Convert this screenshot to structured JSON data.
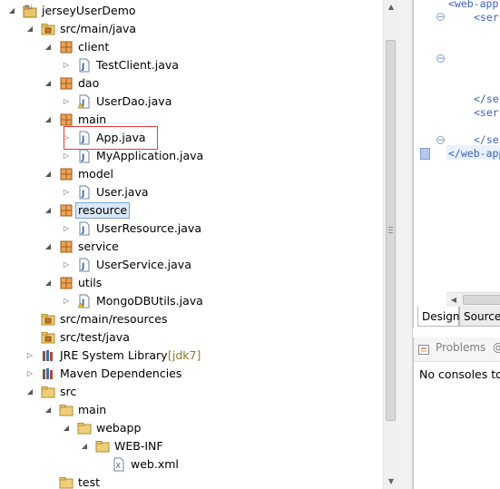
{
  "explorer": {
    "rows": [
      {
        "label": "jerseyUserDemo",
        "depth": 0,
        "twisty": "open",
        "icon": "project-icon"
      },
      {
        "label": "src/main/java",
        "depth": 1,
        "twisty": "open",
        "icon": "source-folder-icon"
      },
      {
        "label": "client",
        "depth": 2,
        "twisty": "open",
        "icon": "package-icon"
      },
      {
        "label": "TestClient.java",
        "depth": 3,
        "twisty": "closed",
        "icon": "java-file-icon"
      },
      {
        "label": "dao",
        "depth": 2,
        "twisty": "open",
        "icon": "package-icon"
      },
      {
        "label": "UserDao.java",
        "depth": 3,
        "twisty": "closed",
        "icon": "java-file-warn-icon"
      },
      {
        "label": "main",
        "depth": 2,
        "twisty": "open",
        "icon": "package-icon"
      },
      {
        "label": "App.java",
        "depth": 3,
        "twisty": "closed",
        "icon": "java-file-icon"
      },
      {
        "label": "MyApplication.java",
        "depth": 3,
        "twisty": "closed",
        "icon": "java-file-icon"
      },
      {
        "label": "model",
        "depth": 2,
        "twisty": "open",
        "icon": "package-icon"
      },
      {
        "label": "User.java",
        "depth": 3,
        "twisty": "closed",
        "icon": "java-file-icon"
      },
      {
        "label": "resource",
        "depth": 2,
        "twisty": "open",
        "icon": "package-icon",
        "selected": true
      },
      {
        "label": "UserResource.java",
        "depth": 3,
        "twisty": "closed",
        "icon": "java-file-icon"
      },
      {
        "label": "service",
        "depth": 2,
        "twisty": "open",
        "icon": "package-icon"
      },
      {
        "label": "UserService.java",
        "depth": 3,
        "twisty": "closed",
        "icon": "java-file-icon"
      },
      {
        "label": "utils",
        "depth": 2,
        "twisty": "open",
        "icon": "package-icon"
      },
      {
        "label": "MongoDBUtils.java",
        "depth": 3,
        "twisty": "closed",
        "icon": "java-file-warn-icon"
      },
      {
        "label": "src/main/resources",
        "depth": 1,
        "twisty": "none",
        "icon": "source-folder-icon"
      },
      {
        "label": "src/test/java",
        "depth": 1,
        "twisty": "none",
        "icon": "source-folder-icon"
      },
      {
        "label": "JRE System Library",
        "decoration": " [jdk7]",
        "depth": 1,
        "twisty": "closed",
        "icon": "library-icon"
      },
      {
        "label": "Maven Dependencies",
        "depth": 1,
        "twisty": "closed",
        "icon": "library-icon"
      },
      {
        "label": "src",
        "depth": 1,
        "twisty": "open",
        "icon": "folder-icon"
      },
      {
        "label": "main",
        "depth": 2,
        "twisty": "open",
        "icon": "folder-icon"
      },
      {
        "label": "webapp",
        "depth": 3,
        "twisty": "open",
        "icon": "folder-icon"
      },
      {
        "label": "WEB-INF",
        "depth": 4,
        "twisty": "open",
        "icon": "folder-icon"
      },
      {
        "label": "web.xml",
        "depth": 5,
        "twisty": "none",
        "icon": "xml-file-icon"
      },
      {
        "label": "test",
        "depth": 2,
        "twisty": "none",
        "icon": "folder-icon"
      }
    ]
  },
  "editor": {
    "lines": [
      {
        "text": "<web-app",
        "indent": 0,
        "row": 0
      },
      {
        "text": "<ser",
        "indent": 1,
        "row": 1
      },
      {
        "text": "</se",
        "indent": 1,
        "row": 7
      },
      {
        "text": "<ser",
        "indent": 1,
        "row": 8
      },
      {
        "text": "</se",
        "indent": 1,
        "row": 10
      },
      {
        "text": "</web-app",
        "indent": 0,
        "row": 11
      }
    ],
    "tab_design": "Design",
    "tab_source": "Source"
  },
  "console": {
    "tab_problems": "Problems",
    "tab_at": "@",
    "message": "No consoles to"
  }
}
